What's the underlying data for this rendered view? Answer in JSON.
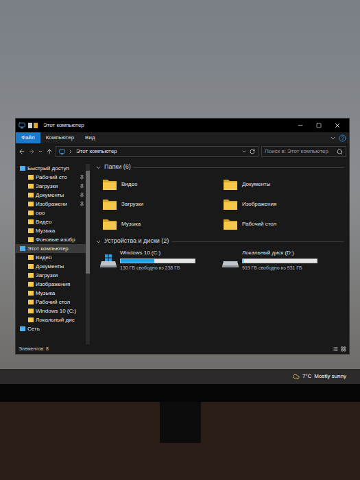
{
  "window": {
    "title": "Этот компьютер"
  },
  "ribbon_tabs": [
    {
      "label": "Файл",
      "selected": true
    },
    {
      "label": "Компьютер",
      "selected": false
    },
    {
      "label": "Вид",
      "selected": false
    }
  ],
  "address": {
    "path": "Этот компьютер"
  },
  "search": {
    "placeholder": "Поиск в: Этот компьютер"
  },
  "sidebar": {
    "items": [
      {
        "label": "Быстрый доступ",
        "kind": "root",
        "pinned": false,
        "selected": false
      },
      {
        "label": "Рабочий сто",
        "kind": "child",
        "pinned": true,
        "selected": false
      },
      {
        "label": "Загрузки",
        "kind": "child",
        "pinned": true,
        "selected": false
      },
      {
        "label": "Документы",
        "kind": "child",
        "pinned": true,
        "selected": false
      },
      {
        "label": "Изображени",
        "kind": "child",
        "pinned": true,
        "selected": false
      },
      {
        "label": "ooo",
        "kind": "child",
        "pinned": false,
        "selected": false
      },
      {
        "label": "Видео",
        "kind": "child",
        "pinned": false,
        "selected": false
      },
      {
        "label": "Музыка",
        "kind": "child",
        "pinned": false,
        "selected": false
      },
      {
        "label": "Фоновые изобр",
        "kind": "child",
        "pinned": false,
        "selected": false
      },
      {
        "label": "Этот компьютер",
        "kind": "root",
        "pinned": false,
        "selected": true
      },
      {
        "label": "Видео",
        "kind": "child",
        "pinned": false,
        "selected": false
      },
      {
        "label": "Документы",
        "kind": "child",
        "pinned": false,
        "selected": false
      },
      {
        "label": "Загрузки",
        "kind": "child",
        "pinned": false,
        "selected": false
      },
      {
        "label": "Изображения",
        "kind": "child",
        "pinned": false,
        "selected": false
      },
      {
        "label": "Музыка",
        "kind": "child",
        "pinned": false,
        "selected": false
      },
      {
        "label": "Рабочий стол",
        "kind": "child",
        "pinned": false,
        "selected": false
      },
      {
        "label": "Windows 10 (C:)",
        "kind": "child",
        "pinned": false,
        "selected": false
      },
      {
        "label": "Локальный дис",
        "kind": "child",
        "pinned": false,
        "selected": false
      },
      {
        "label": "Сеть",
        "kind": "root",
        "pinned": false,
        "selected": false
      }
    ]
  },
  "folders_section": {
    "title": "Папки (6)",
    "expanded": true,
    "items": [
      {
        "label": "Видео"
      },
      {
        "label": "Документы"
      },
      {
        "label": "Загрузки"
      },
      {
        "label": "Изображения"
      },
      {
        "label": "Музыка"
      },
      {
        "label": "Рабочий стол"
      }
    ]
  },
  "drives_section": {
    "title": "Устройства и диски (2)",
    "expanded": true,
    "items": [
      {
        "name": "Windows 10 (C:)",
        "free": "130 ГБ свободно из 238 ГБ",
        "level": 0.45
      },
      {
        "name": "Локальный диск (D:)",
        "free": "919 ГБ свободно из 931 ГБ",
        "level": 0.013
      }
    ]
  },
  "status_bar": {
    "text": "Элементов: 8"
  },
  "taskbar": {
    "temperature": "7°C",
    "weather": "Mostly sunny"
  }
}
